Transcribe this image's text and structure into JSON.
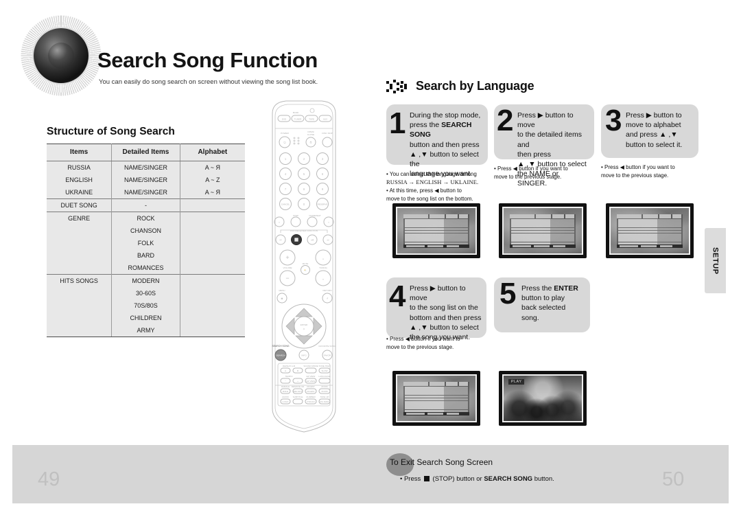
{
  "header": {
    "title": "Search Song Function",
    "subtitle": "You can easily do song search on screen without viewing the song list book.",
    "speaker_icon": "speaker-cone-icon"
  },
  "left": {
    "section_title": "Structure of Song Search",
    "table": {
      "headers": [
        "Items",
        "Detailed Items",
        "Alphabet"
      ],
      "rows": [
        {
          "items": "RUSSIA",
          "detailed": "NAME/SINGER",
          "alphabet": "A ~ Я"
        },
        {
          "items": "ENGLISH",
          "detailed": "NAME/SINGER",
          "alphabet": "A ~ Z"
        },
        {
          "items": "UKRAINE",
          "detailed": "NAME/SINGER",
          "alphabet": "A ~ Я"
        },
        {
          "items": "DUET SONG",
          "detailed": "-",
          "alphabet": ""
        },
        {
          "items": "GENRE",
          "detailed": "ROCK",
          "alphabet": ""
        },
        {
          "items": "",
          "detailed": "CHANSON",
          "alphabet": ""
        },
        {
          "items": "",
          "detailed": "FOLK",
          "alphabet": ""
        },
        {
          "items": "",
          "detailed": "BARD",
          "alphabet": ""
        },
        {
          "items": "",
          "detailed": "ROMANCES",
          "alphabet": ""
        },
        {
          "items": "HITS SONGS",
          "detailed": "MODERN",
          "alphabet": ""
        },
        {
          "items": "",
          "detailed": "30-60S",
          "alphabet": ""
        },
        {
          "items": "",
          "detailed": "70S/80S",
          "alphabet": ""
        },
        {
          "items": "",
          "detailed": "CHILDREN",
          "alphabet": ""
        },
        {
          "items": "",
          "detailed": "ARMY",
          "alphabet": ""
        }
      ]
    }
  },
  "remote": {
    "model_label": "DVD : SONG",
    "source_band_label": "BAND",
    "source_buttons": [
      "DVD",
      "TUNER",
      "TAPE",
      "AUX"
    ],
    "power_label": "POWER",
    "open_close_label": "OPEN/ CLOSE",
    "disc_skip_label": "DISC SKIP",
    "keypad": [
      "1",
      "2",
      "3",
      "4",
      "5",
      "6",
      "7",
      "8",
      "9",
      "0"
    ],
    "cancel_label": "CANCEL",
    "reserve_label": "RESERVE",
    "transport_label": "DVD RECEIVER FUNCTION",
    "volume_label": "VOLUME",
    "mute_label": "MUTE",
    "tuning_label": "TUNING",
    "menu_label": "MENU",
    "return_label": "RETURN",
    "enter_label": "ENTER",
    "search_song_label": "SEARCH SONG",
    "info_label": "INFO",
    "favorite_song_label": "FAVORITE SONG",
    "repeat_ab_label": "REPEAT A-B",
    "sound_mode_label": "SOUND MODE",
    "tempo_label": "TEMPO",
    "tone_high_label": "TONE HIGH",
    "slow_label": "SLOW",
    "ez_view_label": "EZ VIEW",
    "language_label": "LANGUAGE",
    "digest_label": "DIGEST",
    "zoom_label": "ZOOM",
    "female_label": "FEMALE",
    "male_label": "MALE",
    "remove_ad_label": "REMOVE AD",
    "melody_label": "MELODY",
    "audio_label": "AUDIO",
    "logo_label": "LOGO",
    "subtitle_label": "SUBTITLE",
    "number_label": "NUMBER",
    "take_up_label": "TAKE UP",
    "p_scan_label": "P.SCAN",
    "rg_main_label": "RG MAIN",
    "highlighted_buttons": [
      "stop-button",
      "search-song-button"
    ]
  },
  "right": {
    "section_heading": "Search by Language",
    "section_icon": "arrows-blocks-icon",
    "steps": [
      {
        "number": "1",
        "lines": [
          {
            "text": "During the stop mode,"
          },
          {
            "text": "press the ",
            "bold": "SEARCH SONG"
          },
          {
            "text": "button and then press"
          },
          {
            "text": "▲ ,▼ button to select the"
          },
          {
            "text": "language you want."
          }
        ],
        "notes": [
          "• You can select the language among",
          "RUSSIA → ENGLISH → UKLAINE.",
          "• At this time, press ◀ button to",
          "move to the song list on the bottom."
        ],
        "screen": "song-list-menu"
      },
      {
        "number": "2",
        "lines": [
          {
            "text": "Press ▶ button to move"
          },
          {
            "text": "to the detailed items and"
          },
          {
            "text": "then press"
          },
          {
            "text": "▲ ,▼ button to select"
          },
          {
            "text": "the NAME or SINGER."
          }
        ],
        "notes": [
          "• Press ◀ button if you want to",
          "move to the previous stage."
        ],
        "screen": "song-list-menu"
      },
      {
        "number": "3",
        "lines": [
          {
            "text": "Press ▶ button to"
          },
          {
            "text": "move to alphabet"
          },
          {
            "text": "and press ▲ ,▼"
          },
          {
            "text": "button to select it."
          }
        ],
        "notes": [
          "• Press ◀ button if you want to",
          "move to the previous stage."
        ],
        "screen": "song-list-menu"
      },
      {
        "number": "4",
        "lines": [
          {
            "text": "Press ▶ button to move"
          },
          {
            "text": "to the song list on the"
          },
          {
            "text": "bottom and then press"
          },
          {
            "text": "▲ ,▼ button to select"
          },
          {
            "text": "the song you want."
          }
        ],
        "notes": [
          "• Press ◀ button if you want to",
          "move to the previous stage."
        ],
        "screen": "song-list-menu"
      },
      {
        "number": "5",
        "lines": [
          {
            "text": "Press the ",
            "bold": "ENTER"
          },
          {
            "text": "button to play"
          },
          {
            "text": "back selected"
          },
          {
            "text": "song."
          }
        ],
        "notes": [],
        "screen": "video-playback",
        "screen_badge": "PLAY"
      }
    ]
  },
  "setup_tab": {
    "label": "SETUP"
  },
  "footer": {
    "page_left": "49",
    "page_right": "50",
    "exit_title": "To Exit Search Song Screen",
    "exit_note_pre": "• Press ",
    "exit_note_mid": " (STOP) button or ",
    "exit_note_bold": "SEARCH SONG",
    "exit_note_post": " button."
  },
  "colors": {
    "bubble_gray": "#d8d8d8",
    "footer_gray": "#d6d6d6",
    "table_gray": "#e8e8e8",
    "page_number": "#c0c0c0",
    "ink": "#111111"
  }
}
